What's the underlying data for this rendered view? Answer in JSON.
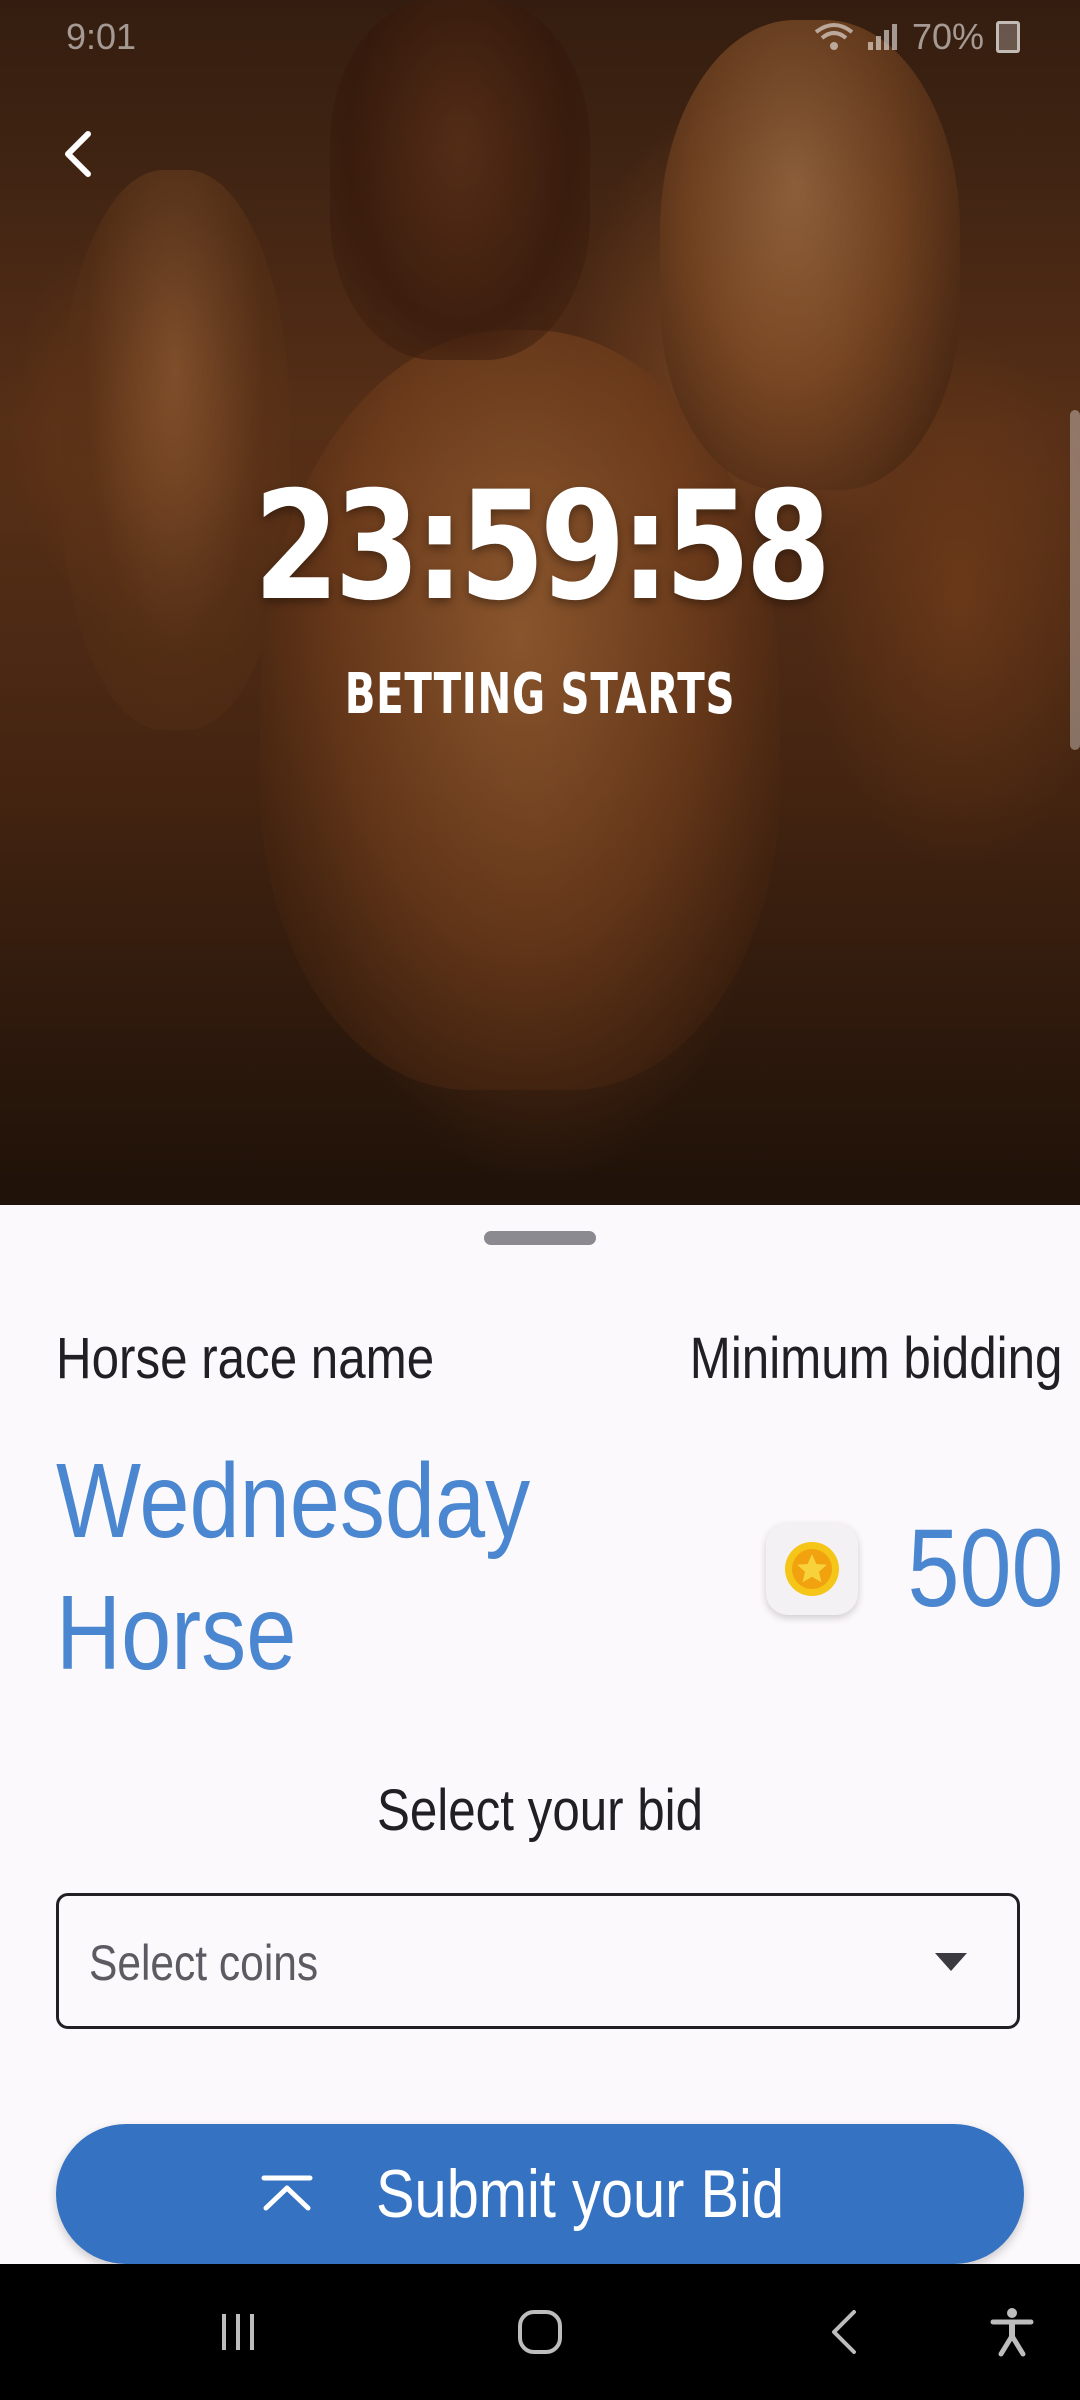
{
  "status_bar": {
    "time": "9:01",
    "battery": "70%"
  },
  "hero": {
    "countdown": "23:59:58",
    "caption": "BETTING STARTS"
  },
  "race": {
    "name_label": "Horse race name",
    "name_value": "Wednesday Horse",
    "min_bid_label": "Minimum bidding",
    "min_bid_value": "500"
  },
  "bid": {
    "select_label": "Select your bid",
    "select_placeholder": "Select coins"
  },
  "submit": {
    "label": "Submit your Bid"
  },
  "colors": {
    "accent_blue": "#4a87d0",
    "button_blue": "#3572c2",
    "coin_gold": "#f5c518"
  },
  "icons": {
    "back": "chevron-left-icon",
    "coin": "star-coin-icon",
    "dropdown": "caret-down-icon",
    "submit": "double-up-arrow-icon",
    "nav_recents": "recents-icon",
    "nav_home": "home-icon",
    "nav_back": "back-icon",
    "nav_accessibility": "accessibility-icon"
  }
}
